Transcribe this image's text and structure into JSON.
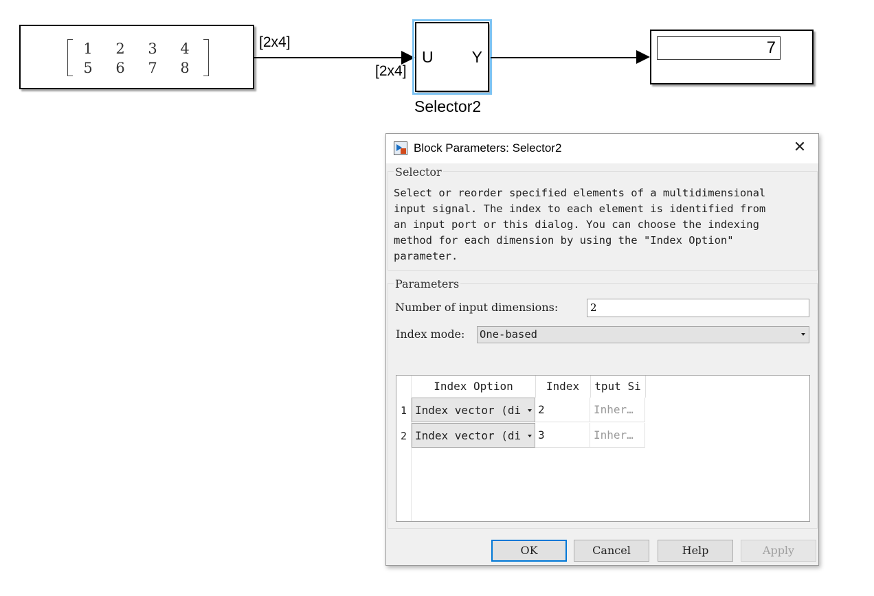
{
  "canvas": {
    "constant_block": {
      "matrix": [
        [
          "1",
          "2",
          "3",
          "4"
        ],
        [
          "5",
          "6",
          "7",
          "8"
        ]
      ]
    },
    "signal_label_out": "[2x4]",
    "signal_label_in": "[2x4]",
    "selector_block": {
      "port_in": "U",
      "port_out": "Y",
      "name": "Selector2"
    },
    "display_block": {
      "value": "7"
    }
  },
  "dialog": {
    "title": "Block Parameters: Selector2",
    "selector_group": {
      "legend": "Selector",
      "description": "Select or reorder specified elements of a multidimensional\ninput signal. The index to each element is identified from\nan input port or this dialog. You can choose the indexing\nmethod for each dimension by using the \"Index Option\"\nparameter."
    },
    "params_group": {
      "legend": "Parameters",
      "num_dims_label": "Number of input dimensions:",
      "num_dims_value": "2",
      "index_mode_label": "Index mode:",
      "index_mode_value": "One-based"
    },
    "table": {
      "columns": [
        "Index Option",
        "Index",
        "tput Si"
      ],
      "rows": [
        {
          "num": "1",
          "option": "Index vector (di",
          "index": "2",
          "output_size": "Inher…"
        },
        {
          "num": "2",
          "option": "Index vector (di",
          "index": "3",
          "output_size": "Inher…"
        }
      ]
    },
    "buttons": {
      "ok": "OK",
      "cancel": "Cancel",
      "help": "Help",
      "apply": "Apply"
    }
  },
  "colors": {
    "selection_highlight": "#7ec3f2",
    "default_button_border": "#0078d7"
  },
  "icons": [
    "block-parameters-icon",
    "close-icon",
    "dropdown-caret-icon",
    "arrowhead-icon"
  ]
}
